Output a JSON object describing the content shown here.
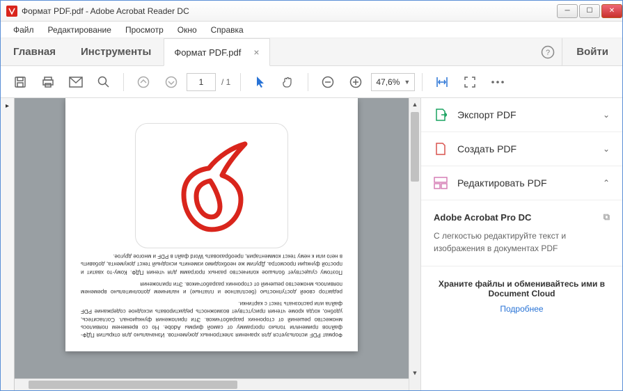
{
  "window": {
    "title": "Формат PDF.pdf - Adobe Acrobat Reader DC"
  },
  "menu": {
    "items": [
      "Файл",
      "Редактирование",
      "Просмотр",
      "Окно",
      "Справка"
    ]
  },
  "tabs": {
    "home": "Главная",
    "tools": "Инструменты",
    "doc": "Формат PDF.pdf",
    "login": "Войти"
  },
  "toolbar": {
    "page_current": "1",
    "page_total": "/ 1",
    "zoom": "47,6%"
  },
  "rightpanel": {
    "export": "Экспорт PDF",
    "create": "Создать PDF",
    "edit": "Редактировать PDF",
    "promo_title": "Adobe Acrobat Pro DC",
    "promo_desc": "С легкостью редактируйте текст и изображения в документах PDF",
    "cloud_title": "Храните файлы и обменивайтесь ими в Document Cloud",
    "cloud_link": "Подробнее"
  },
  "document": {
    "p1": "Формат PDF используется для хранения электронных документов. Изначально для открытия ПДФ-файлов применяли только программу от самой фирмы Adobe. Но со временем появилось множество решений от сторонних разработчиков. Эти приложения функционал. Согласитесь, удобно, когда кроме чтения присутствует возможность редактировать исходное содержание PDF файла или распознать текст с картинки.",
    "p2": "редактор своей доступностью (бесплатное и платные) и наличием дополнительно временем появилось множество решений от сторонних разработчиков. Эти приложения",
    "p3": "Поэтому существует большое количество разных программ для чтения ПДФ. Кому-то хватит и простой функции просмотра. Другим же необходимо изменить исходный текст документа, добавить в него или к нему текст комментария, преобразовать Word файл в PDF и многое другое."
  }
}
